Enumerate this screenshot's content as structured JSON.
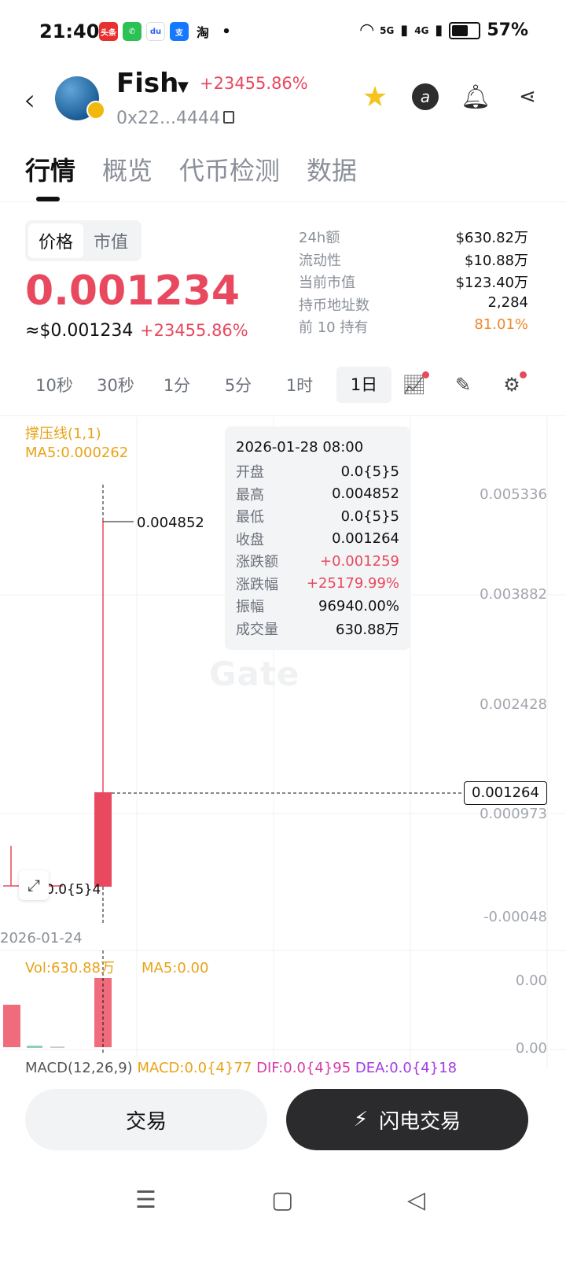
{
  "status_bar": {
    "time": "21:40",
    "apps": [
      "头条",
      "",
      "du",
      "支",
      "淘"
    ],
    "dot": "•",
    "network1": "5G",
    "network2": "4G",
    "battery": "57%"
  },
  "header": {
    "token_name": "Fish",
    "change": "+23455.86%",
    "address": "0x22...4444",
    "icons": [
      "star-icon",
      "a-icon",
      "bell-icon",
      "share-icon"
    ]
  },
  "tabs": [
    "行情",
    "概览",
    "代币检测",
    "数据"
  ],
  "price_section": {
    "toggle": [
      "价格",
      "市值"
    ],
    "price": "0.001234",
    "usd_price": "≈$0.001234",
    "usd_change": "+23455.86%",
    "stats": [
      {
        "label": "24h额",
        "value": "$630.82万"
      },
      {
        "label": "流动性",
        "value": "$10.88万"
      },
      {
        "label": "当前市值",
        "value": "$123.40万"
      },
      {
        "label": "持币地址数",
        "value": "2,284"
      },
      {
        "label": "前 10 持有",
        "value": "81.01%"
      }
    ]
  },
  "intervals": [
    "10秒",
    "30秒",
    "1分",
    "5分",
    "1时",
    "1日"
  ],
  "chart": {
    "legend_line1": "撑压线(1,1)",
    "legend_line2": "MA5:0.000262",
    "y_labels": [
      "0.005336",
      "0.003882",
      "0.002428",
      "0.000973",
      "-0.00048"
    ],
    "current_price": "0.001264",
    "high_label": "0.004852",
    "low_label": "0.0{5}4",
    "date_label": "2026-01-24",
    "watermark": "Gate",
    "tooltip": {
      "date": "2026-01-28 08:00",
      "rows": [
        {
          "label": "开盘",
          "value": "0.0{5}5",
          "color": ""
        },
        {
          "label": "最高",
          "value": "0.004852",
          "color": ""
        },
        {
          "label": "最低",
          "value": "0.0{5}5",
          "color": ""
        },
        {
          "label": "收盘",
          "value": "0.001264",
          "color": ""
        },
        {
          "label": "涨跌额",
          "value": "+0.001259",
          "color": "red"
        },
        {
          "label": "涨跌幅",
          "value": "+25179.99%",
          "color": "red"
        },
        {
          "label": "振幅",
          "value": "96940.00%",
          "color": ""
        },
        {
          "label": "成交量",
          "value": "630.88万",
          "color": ""
        }
      ]
    },
    "vol_legend": "Vol:630.88万",
    "vol_ma5": "MA5:0.00",
    "vol_labels": [
      "0.00",
      "0.00"
    ],
    "macd_name": "MACD(12,26,9)",
    "macd_value": "MACD:0.0{4}77",
    "dif_value": "DIF:0.0{4}95",
    "dea_value": "DEA:0.0{4}18"
  },
  "buttons": {
    "trade": "交易",
    "flash": "闪电交易"
  },
  "colors": {
    "up": "#e8495e",
    "accent": "#f6c21c",
    "legend": "#e8a317",
    "holder": "#f0872e"
  }
}
